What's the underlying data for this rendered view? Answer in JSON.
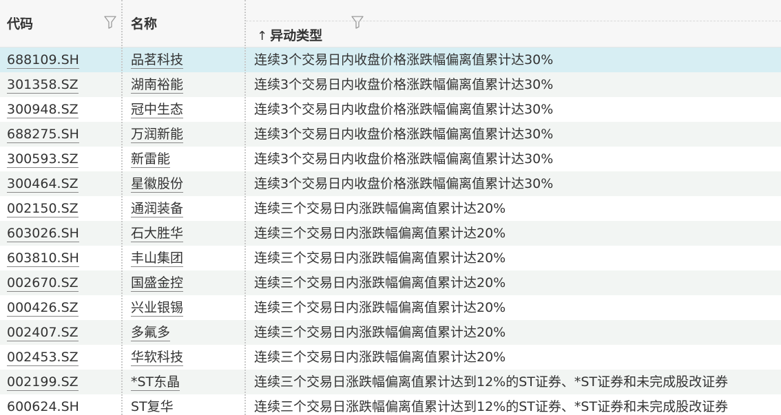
{
  "header": {
    "code_label": "代码",
    "name_label": "名称",
    "type_label": "异动类型",
    "sort_arrow": "↑"
  },
  "rows": [
    {
      "code": "688109.SH",
      "name": "品茗科技",
      "type": "连续3个交易日内收盘价格涨跌幅偏离值累计达30%"
    },
    {
      "code": "301358.SZ",
      "name": "湖南裕能",
      "type": "连续3个交易日内收盘价格涨跌幅偏离值累计达30%"
    },
    {
      "code": "300948.SZ",
      "name": "冠中生态",
      "type": "连续3个交易日内收盘价格涨跌幅偏离值累计达30%"
    },
    {
      "code": "688275.SH",
      "name": "万润新能",
      "type": "连续3个交易日内收盘价格涨跌幅偏离值累计达30%"
    },
    {
      "code": "300593.SZ",
      "name": "新雷能",
      "type": "连续3个交易日内收盘价格涨跌幅偏离值累计达30%"
    },
    {
      "code": "300464.SZ",
      "name": "星徽股份",
      "type": "连续3个交易日内收盘价格涨跌幅偏离值累计达30%"
    },
    {
      "code": "002150.SZ",
      "name": "通润装备",
      "type": "连续三个交易日内涨跌幅偏离值累计达20%"
    },
    {
      "code": "603026.SH",
      "name": "石大胜华",
      "type": "连续三个交易日内涨跌幅偏离值累计达20%"
    },
    {
      "code": "603810.SH",
      "name": "丰山集团",
      "type": "连续三个交易日内涨跌幅偏离值累计达20%"
    },
    {
      "code": "002670.SZ",
      "name": "国盛金控",
      "type": "连续三个交易日内涨跌幅偏离值累计达20%"
    },
    {
      "code": "000426.SZ",
      "name": "兴业银锡",
      "type": "连续三个交易日内涨跌幅偏离值累计达20%"
    },
    {
      "code": "002407.SZ",
      "name": "多氟多",
      "type": "连续三个交易日内涨跌幅偏离值累计达20%"
    },
    {
      "code": "002453.SZ",
      "name": "华软科技",
      "type": "连续三个交易日内涨跌幅偏离值累计达20%"
    },
    {
      "code": "002199.SZ",
      "name": "*ST东晶",
      "type": "连续三个交易日涨跌幅偏离值累计达到12%的ST证券、*ST证券和未完成股改证券"
    },
    {
      "code": "600624.SH",
      "name": "ST复华",
      "type": "连续三个交易日涨跌幅偏离值累计达到12%的ST证券、*ST证券和未完成股改证券"
    }
  ],
  "icons": {
    "filter": "filter-icon",
    "sort": "sort-ascending-icon"
  },
  "colors": {
    "header_bg": "#f7f7f7",
    "selected_row_bg": "#d7eef3",
    "alt_row_bg": "#f2f5f3",
    "text": "#333333"
  },
  "selected_row_index": 0
}
